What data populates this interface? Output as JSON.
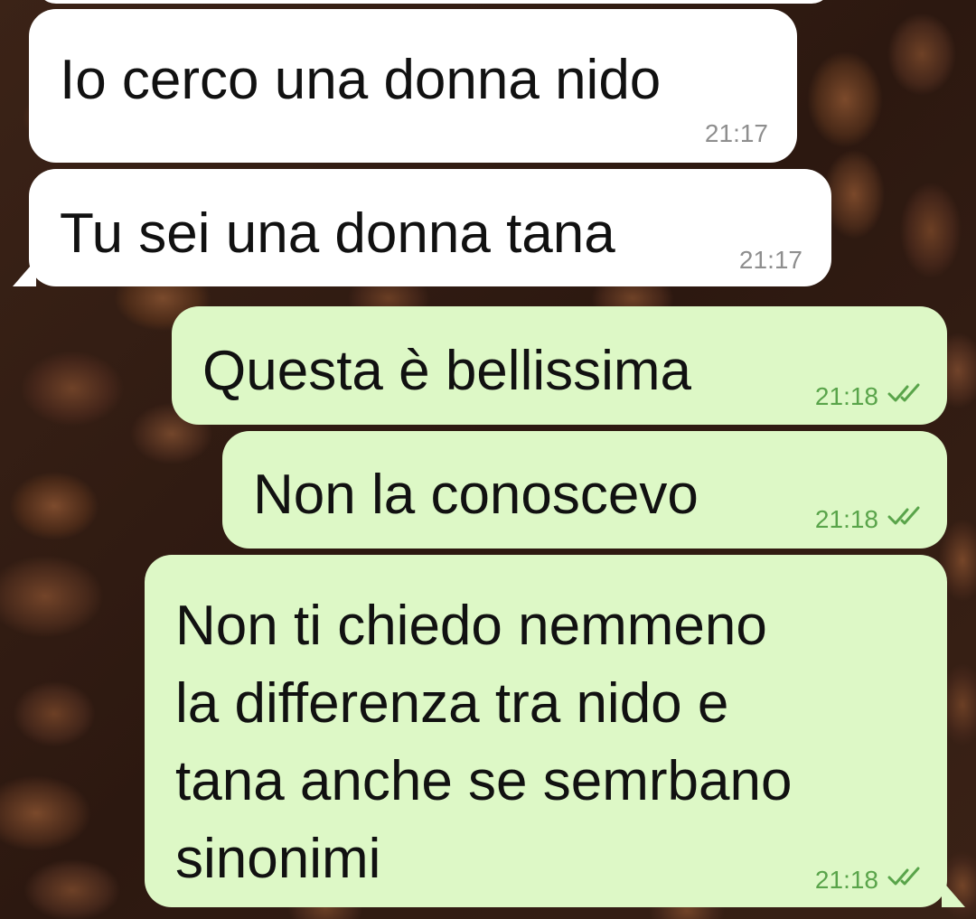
{
  "theme": {
    "incoming_bubble": "#ffffff",
    "outgoing_bubble": "#ddf8c6",
    "outgoing_time": "#59a44a",
    "incoming_time": "#8e8e8e",
    "read_ticks": "#59a44a",
    "wallpaper": "coffee-beans"
  },
  "messages": [
    {
      "direction": "in",
      "text": "Io cerco una donna nido",
      "time": "21:17"
    },
    {
      "direction": "in",
      "text": "Tu sei una donna tana",
      "time": "21:17"
    },
    {
      "direction": "out",
      "text": "Questa è bellissima",
      "time": "21:18",
      "status": "read-double-check-icon"
    },
    {
      "direction": "out",
      "text": "Non la conoscevo",
      "time": "21:18",
      "status": "read-double-check-icon"
    },
    {
      "direction": "out",
      "text": "Non ti chiedo nemmeno\nla differenza tra nido e\ntana anche se semrbano\nsinonimi",
      "time": "21:18",
      "status": "read-double-check-icon"
    }
  ]
}
